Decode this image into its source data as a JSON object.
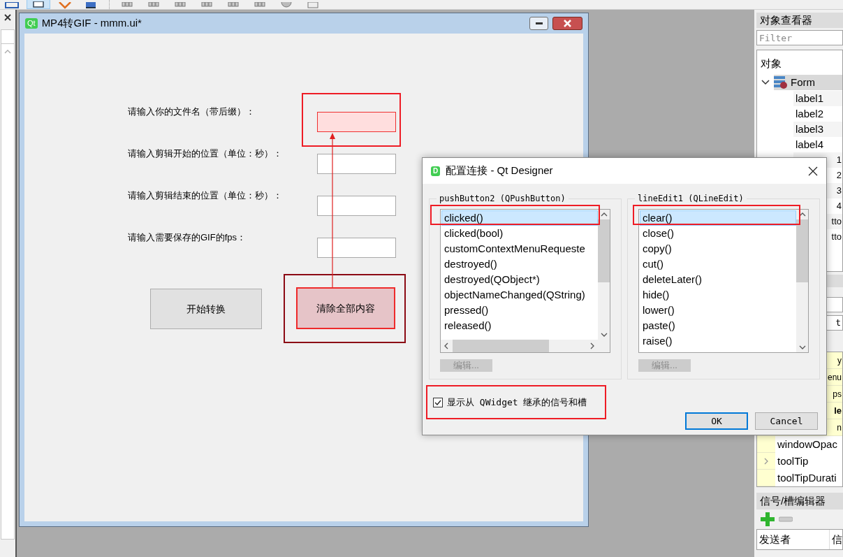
{
  "form_window": {
    "title": "MP4转GIF - mmm.ui*",
    "app_badge": "Qt",
    "fields": [
      {
        "label": "请输入你的文件名（带后缀）：",
        "highlighted": true
      },
      {
        "label": "请输入剪辑开始的位置（单位：秒）：",
        "highlighted": false
      },
      {
        "label": "请输入剪辑结束的位置（单位：秒）：",
        "highlighted": false
      },
      {
        "label": "请输入需要保存的GIF的fps：",
        "highlighted": false
      }
    ],
    "buttons": [
      {
        "label": "开始转换",
        "highlighted": false
      },
      {
        "label": "清除全部内容",
        "highlighted": true
      }
    ]
  },
  "dialog": {
    "title": "配置连接 - Qt Designer",
    "badge": "D",
    "sender": {
      "title": "pushButton2 (QPushButton)",
      "edit": "编辑...",
      "items": [
        {
          "text": "clicked()",
          "selected": true
        },
        {
          "text": "clicked(bool)",
          "selected": false
        },
        {
          "text": "customContextMenuRequeste",
          "selected": false
        },
        {
          "text": "destroyed()",
          "selected": false
        },
        {
          "text": "destroyed(QObject*)",
          "selected": false
        },
        {
          "text": "objectNameChanged(QString)",
          "selected": false
        },
        {
          "text": "pressed()",
          "selected": false
        },
        {
          "text": "released()",
          "selected": false
        }
      ]
    },
    "receiver": {
      "title": "lineEdit1 (QLineEdit)",
      "edit": "编辑...",
      "items": [
        {
          "text": "clear()",
          "selected": true
        },
        {
          "text": "close()",
          "selected": false
        },
        {
          "text": "copy()",
          "selected": false
        },
        {
          "text": "cut()",
          "selected": false
        },
        {
          "text": "deleteLater()",
          "selected": false
        },
        {
          "text": "hide()",
          "selected": false
        },
        {
          "text": "lower()",
          "selected": false
        },
        {
          "text": "paste()",
          "selected": false
        },
        {
          "text": "raise()",
          "selected": false
        }
      ]
    },
    "inherited": {
      "label": "显示从 QWidget 继承的信号和槽",
      "checked": true
    },
    "ok": "OK",
    "cancel": "Cancel"
  },
  "object_inspector": {
    "title": "对象查看器",
    "filter_placeholder": "Filter",
    "column": "对象",
    "root": {
      "text": "Form",
      "expanded": true,
      "selected": true,
      "children": [
        {
          "text": "label1",
          "kind": "full"
        },
        {
          "text": "label2",
          "kind": "full"
        },
        {
          "text": "label3",
          "kind": "full"
        },
        {
          "text": "label4",
          "kind": "full"
        },
        {
          "text": "1",
          "kind": "clipped"
        },
        {
          "text": "2",
          "kind": "clipped"
        },
        {
          "text": "3",
          "kind": "clipped"
        },
        {
          "text": "4",
          "kind": "clipped"
        },
        {
          "text": "tto",
          "kind": "clipped"
        },
        {
          "text": "tto",
          "kind": "clipped"
        }
      ]
    }
  },
  "property_editor": {
    "filter_fragment": "t",
    "rows": [
      {
        "text": "y",
        "kind": "clipped"
      },
      {
        "text": "enu",
        "kind": "clipped"
      },
      {
        "text": "ps",
        "kind": "clipped"
      },
      {
        "text": "le",
        "kind": "group"
      },
      {
        "text": "n",
        "kind": "clipped"
      },
      {
        "text": "windowOpac",
        "kind": "full",
        "expandable": false
      },
      {
        "text": "toolTip",
        "kind": "full",
        "expandable": true
      },
      {
        "text": "toolTipDurati",
        "kind": "full",
        "expandable": false
      }
    ]
  },
  "signal_slot_editor": {
    "title": "信号/槽编辑器",
    "columns": [
      "发送者",
      "信"
    ]
  }
}
